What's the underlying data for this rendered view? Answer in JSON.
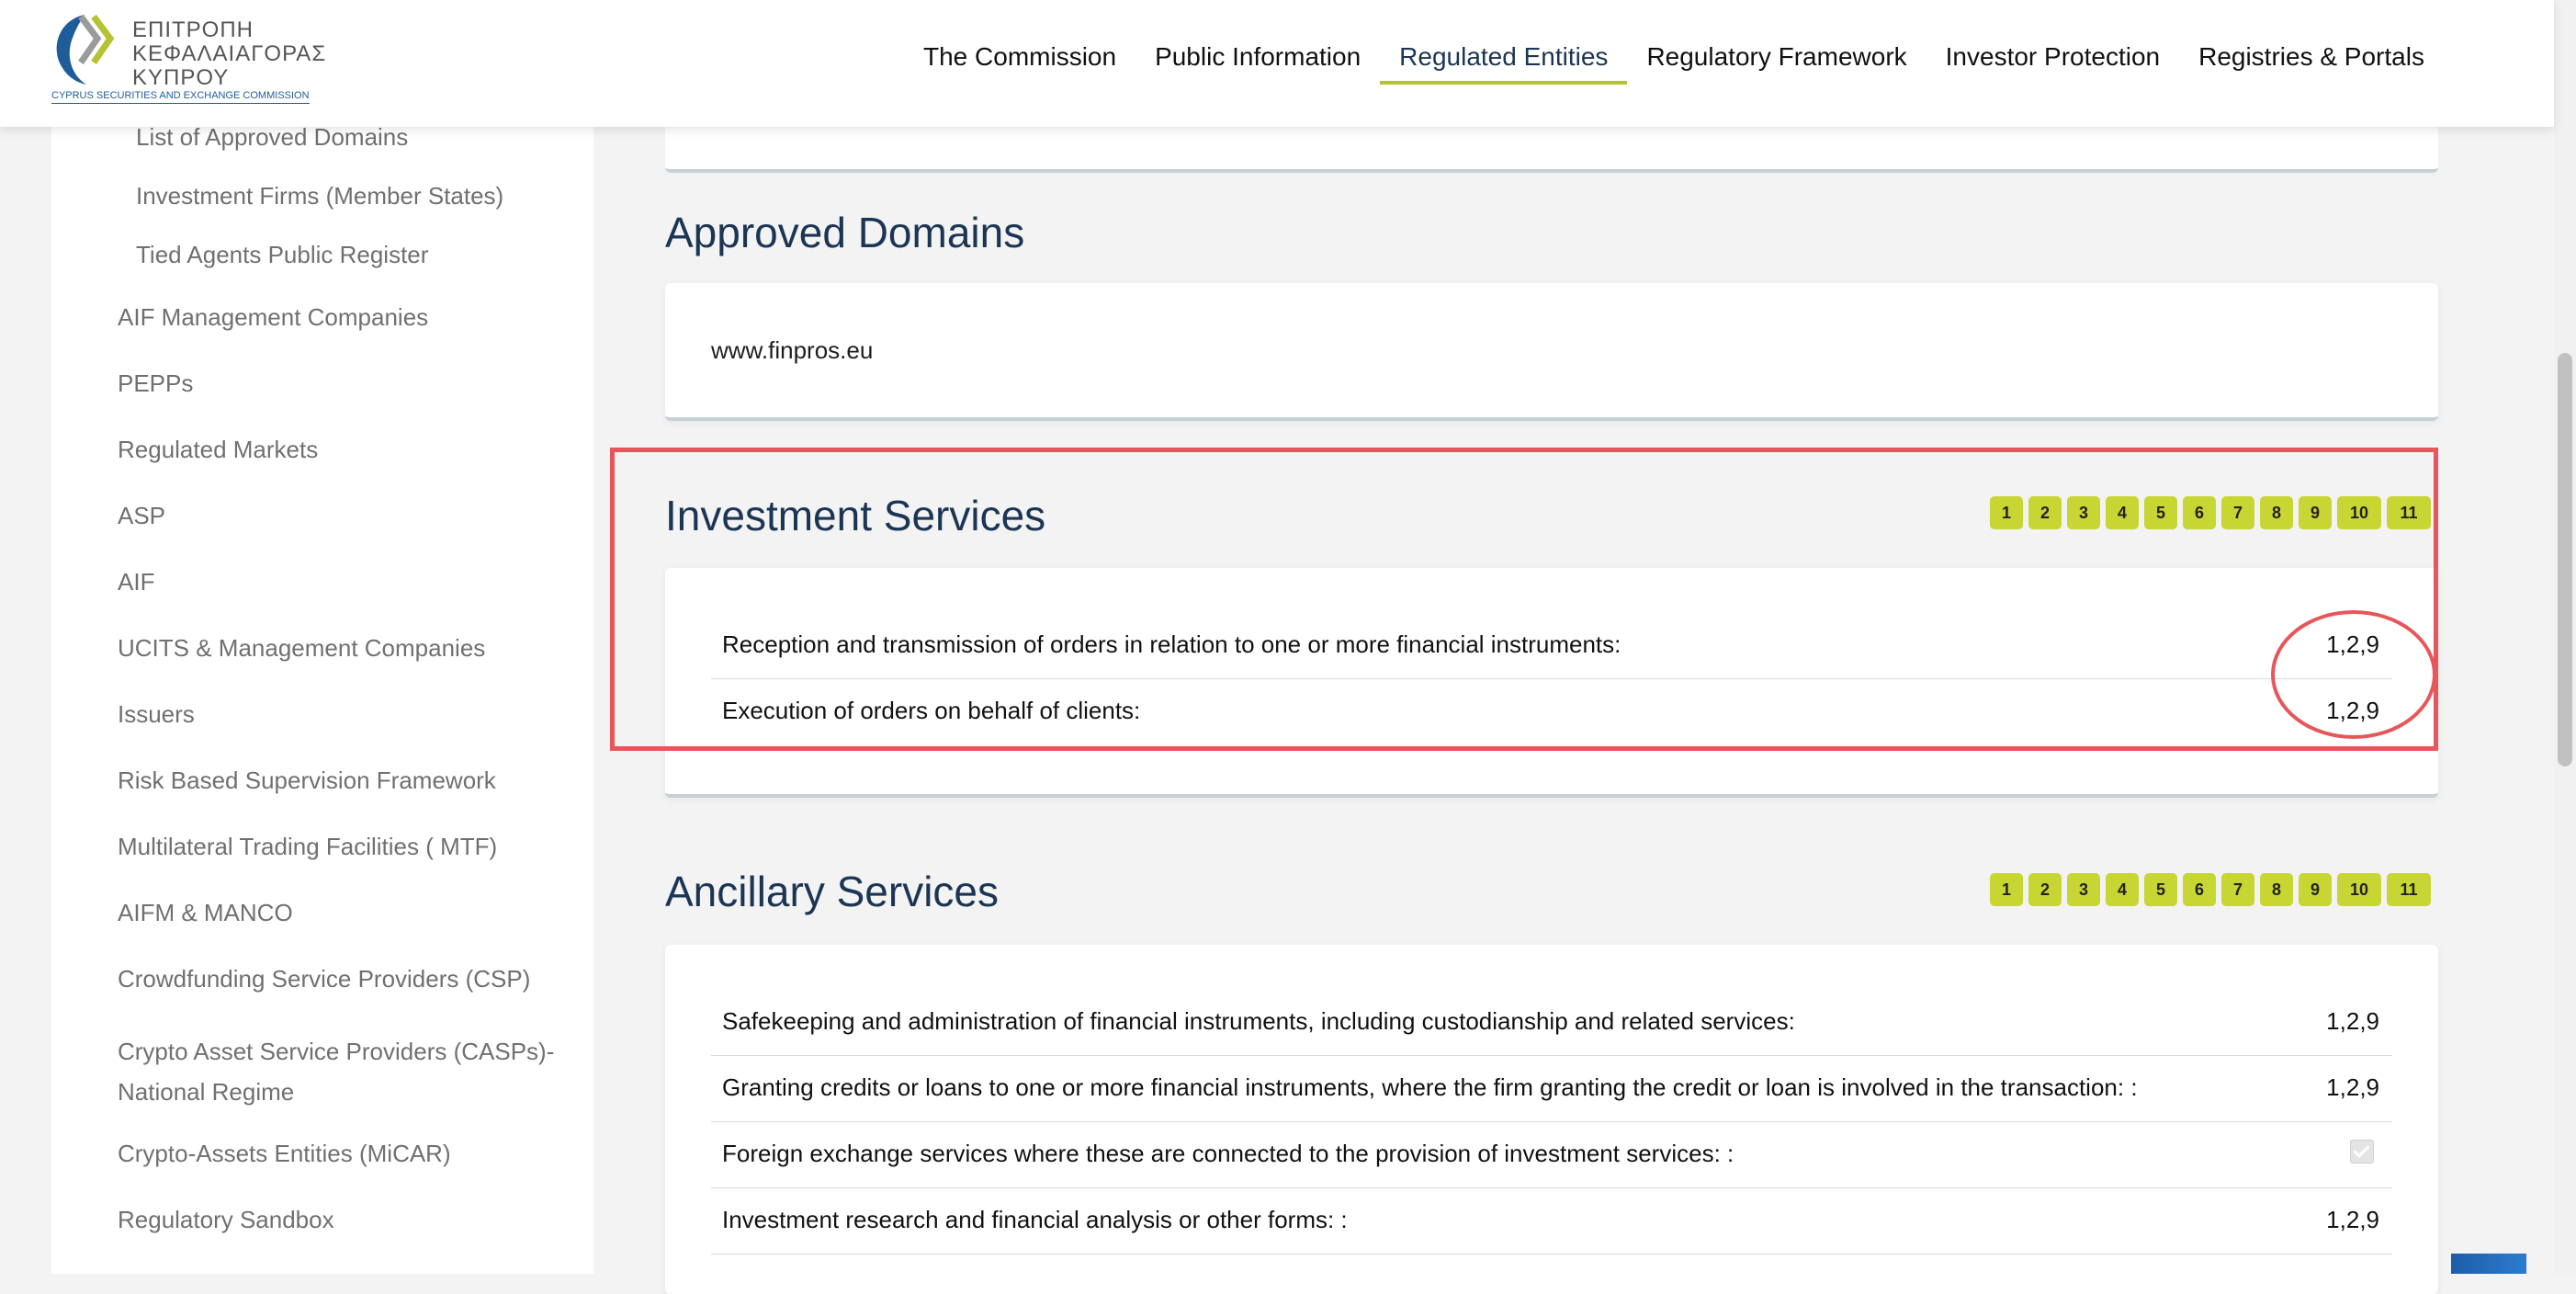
{
  "logo": {
    "greek_line1": "ΕΠΙΤΡΟΠΗ",
    "greek_line2": "ΚΕΦΑΛΑΙΑΓΟΡΑΣ",
    "greek_line3": "ΚΥΠΡΟΥ",
    "english": "CYPRUS SECURITIES AND EXCHANGE COMMISSION",
    "colors": {
      "blue": "#1f5c9a",
      "green": "#b5c234",
      "grey": "#9b9b9b"
    }
  },
  "nav": {
    "items": [
      {
        "label": "The Commission"
      },
      {
        "label": "Public Information"
      },
      {
        "label": "Regulated Entities",
        "active": true
      },
      {
        "label": "Regulatory Framework"
      },
      {
        "label": "Investor Protection"
      },
      {
        "label": "Registries & Portals"
      }
    ],
    "accent": "#b5c234"
  },
  "sidebar": {
    "sub_items": [
      {
        "label": "List of Approved Domains"
      },
      {
        "label": "Investment Firms (Member States)"
      },
      {
        "label": "Tied Agents Public Register"
      }
    ],
    "items": [
      {
        "label": "AIF Management Companies"
      },
      {
        "label": "PEPPs"
      },
      {
        "label": "Regulated Markets"
      },
      {
        "label": "ASP"
      },
      {
        "label": "AIF"
      },
      {
        "label": "UCITS & Management Companies"
      },
      {
        "label": "Issuers"
      },
      {
        "label": "Risk Based Supervision Framework"
      },
      {
        "label": "Multilateral Trading Facilities ( MTF)"
      },
      {
        "label": "AIFM & MANCO"
      },
      {
        "label": "Crowdfunding Service Providers (CSP)"
      },
      {
        "label": "Crypto Asset Service Providers (CASPs)-",
        "line2": "National Regime"
      },
      {
        "label": "Crypto-Assets Entities (MiCAR)"
      },
      {
        "label": "Regulatory Sandbox"
      }
    ]
  },
  "approved_domains": {
    "title": "Approved Domains",
    "domain": "www.finpros.eu"
  },
  "investment_services": {
    "title": "Investment Services",
    "badges": [
      "1",
      "2",
      "3",
      "4",
      "5",
      "6",
      "7",
      "8",
      "9",
      "10",
      "11"
    ],
    "rows": [
      {
        "label": "Reception and transmission of orders in relation to one or more financial instruments:",
        "value": "1,2,9"
      },
      {
        "label": "Execution of orders on behalf of clients:",
        "value": "1,2,9"
      }
    ]
  },
  "ancillary_services": {
    "title": "Ancillary Services",
    "badges": [
      "1",
      "2",
      "3",
      "4",
      "5",
      "6",
      "7",
      "8",
      "9",
      "10",
      "11"
    ],
    "rows": [
      {
        "label": "Safekeeping and administration of financial instruments, including custodianship and related services:",
        "value": "1,2,9"
      },
      {
        "label": "Granting credits or loans to one or more financial instruments, where the firm granting the credit or loan is involved in the transaction: :",
        "value": "1,2,9"
      },
      {
        "label": "Foreign exchange services where these are connected to the provision of investment services: :",
        "value": "",
        "checked": true
      },
      {
        "label": "Investment research and financial analysis or other forms: :",
        "value": "1,2,9"
      }
    ]
  },
  "highlight_color": "#e8555a"
}
